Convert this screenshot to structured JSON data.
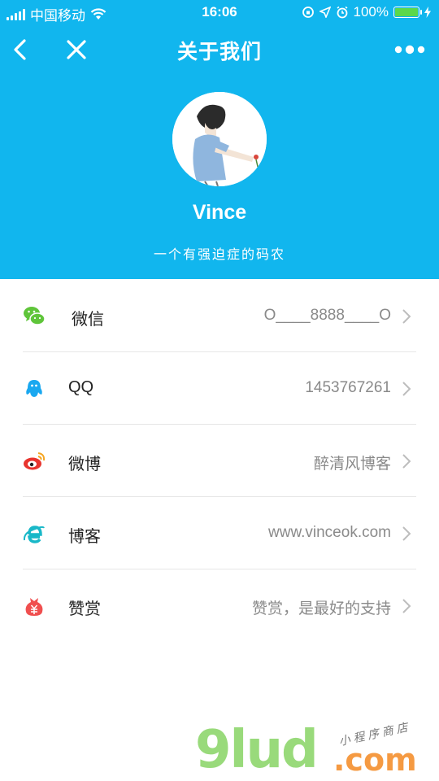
{
  "statusbar": {
    "carrier": "中国移动",
    "time": "16:06",
    "battery_text": "100%",
    "battery_level": 1.0
  },
  "navbar": {
    "title": "关于我们",
    "back_icon": "chevron-left-icon",
    "close_icon": "close-icon",
    "more_icon": "more-dots-icon"
  },
  "profile": {
    "name": "Vince",
    "motto": "一个有强迫症的码农"
  },
  "contacts": [
    {
      "icon": "wechat-icon",
      "label": "微信",
      "value": "O____8888____O"
    },
    {
      "icon": "qq-icon",
      "label": "QQ",
      "value": "1453767261"
    },
    {
      "icon": "weibo-icon",
      "label": "微博",
      "value": "醉清风博客"
    },
    {
      "icon": "ie-browser-icon",
      "label": "博客",
      "value": "www.vinceok.com"
    },
    {
      "icon": "reward-icon",
      "label": "赞赏",
      "value": "赞赏，是最好的支持"
    }
  ],
  "watermark": {
    "brand": "9lud",
    "suffix": ".com",
    "tagline": "小程序商店"
  },
  "colors": {
    "header_bg": "#11b6ee",
    "wechat": "#5fc53a",
    "qq": "#1aa8f0",
    "weibo": "#e8342e",
    "ie": "#19b8c8",
    "reward": "#f04f4f"
  }
}
